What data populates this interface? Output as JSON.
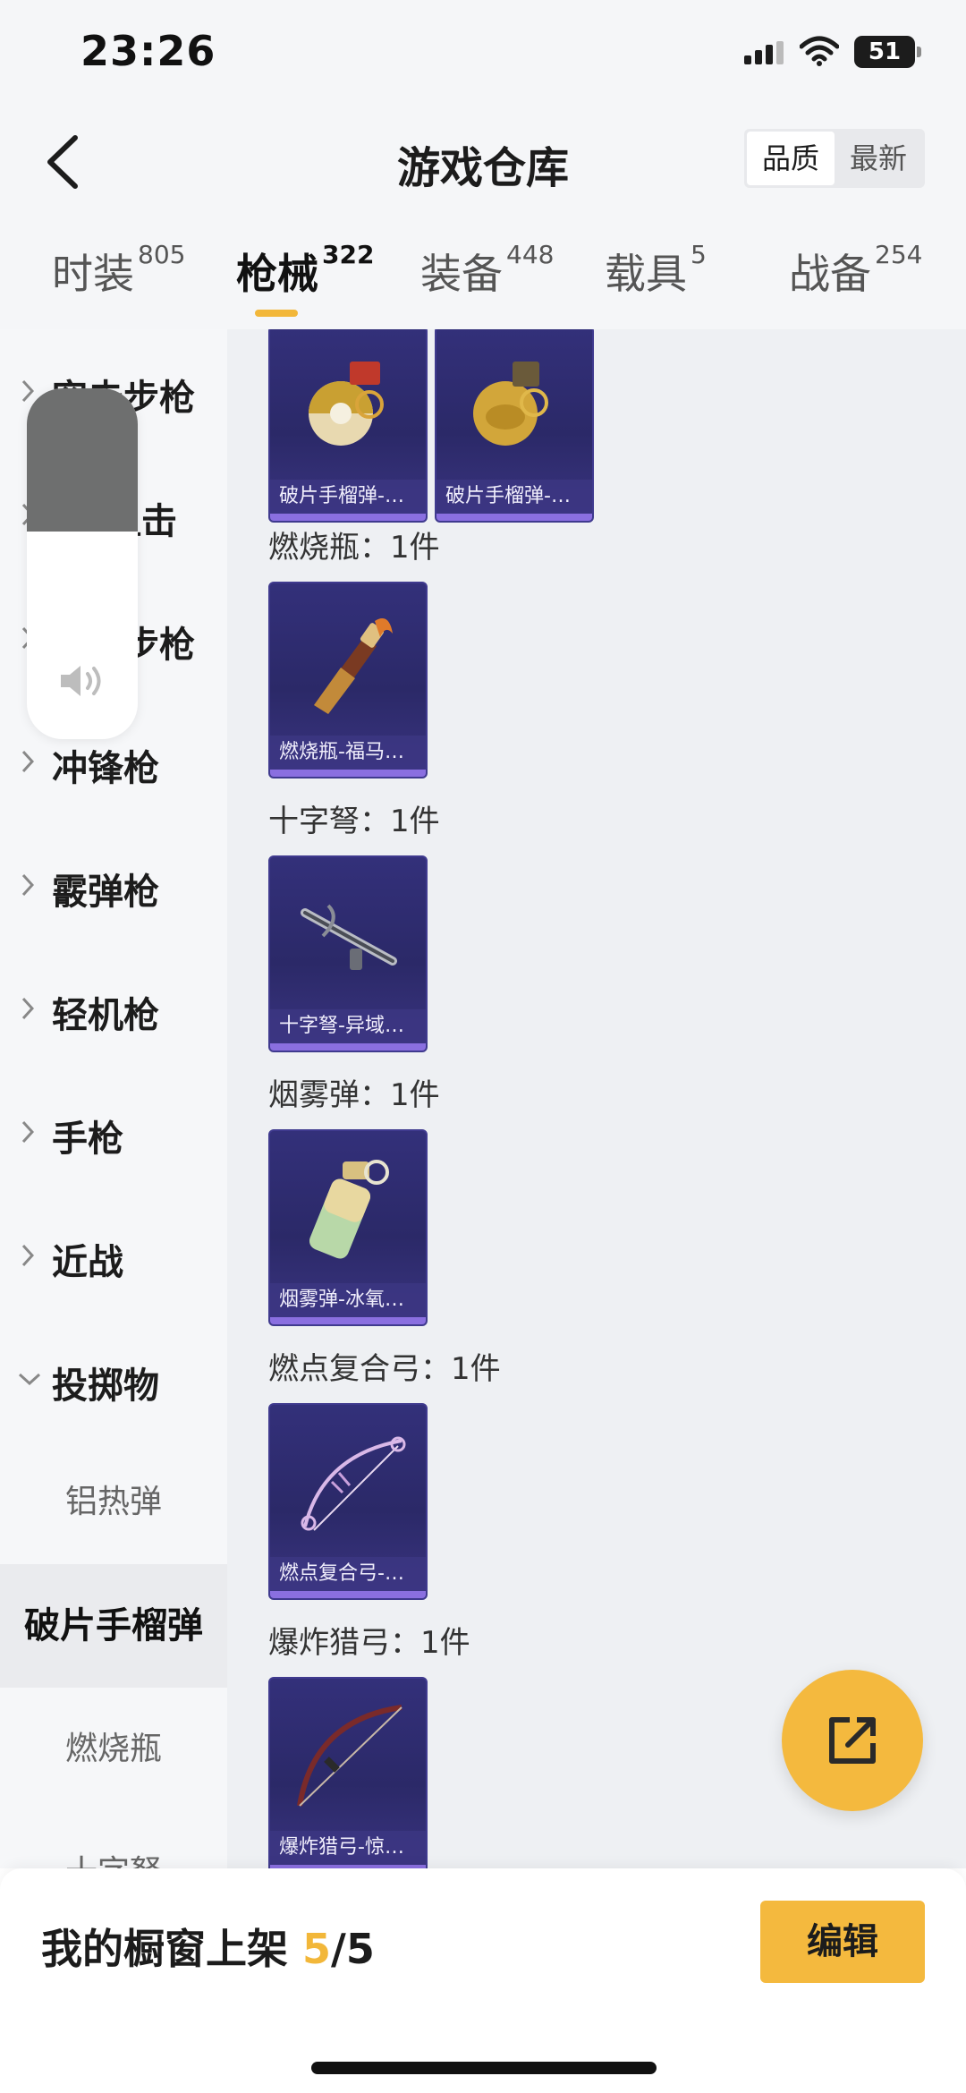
{
  "status_bar": {
    "time": "23:26",
    "battery": "51"
  },
  "header": {
    "title": "游戏仓库",
    "sort_options": [
      "品质",
      "最新"
    ]
  },
  "tabs": [
    {
      "label": "时装",
      "count": "805"
    },
    {
      "label": "枪械",
      "count": "322"
    },
    {
      "label": "装备",
      "count": "448"
    },
    {
      "label": "载具",
      "count": "5"
    },
    {
      "label": "战备",
      "count": "254"
    }
  ],
  "sidebar": {
    "categories": [
      "突击步枪",
      "狙击",
      "步枪",
      "冲锋枪",
      "霰弹枪",
      "轻机枪",
      "手枪",
      "近战",
      "投掷物"
    ],
    "sub_items": [
      "铝热弹",
      "破片手榴弹",
      "燃烧瓶",
      "十字弩"
    ]
  },
  "content": {
    "groups": [
      {
        "label": "燃烧瓶：1件"
      },
      {
        "label": "十字弩：1件"
      },
      {
        "label": "烟雾弹：1件"
      },
      {
        "label": "燃点复合弓：1件"
      },
      {
        "label": "爆炸猎弓：1件"
      }
    ],
    "cards": [
      {
        "name": "破片手榴弹-…"
      },
      {
        "name": "破片手榴弹-…"
      },
      {
        "name": "燃烧瓶-福马…"
      },
      {
        "name": "十字弩-异域…"
      },
      {
        "name": "烟雾弹-冰氧…"
      },
      {
        "name": "燃点复合弓-…"
      },
      {
        "name": "爆炸猎弓-惊…"
      }
    ]
  },
  "bottom_bar": {
    "showcase_label": "我的橱窗上架",
    "count_current": "5",
    "count_total": "/5",
    "edit_label": "编辑"
  },
  "colors": {
    "accent": "#f4b93e",
    "card_bg": "#2b2968",
    "rarity": "#8a6fe0"
  }
}
